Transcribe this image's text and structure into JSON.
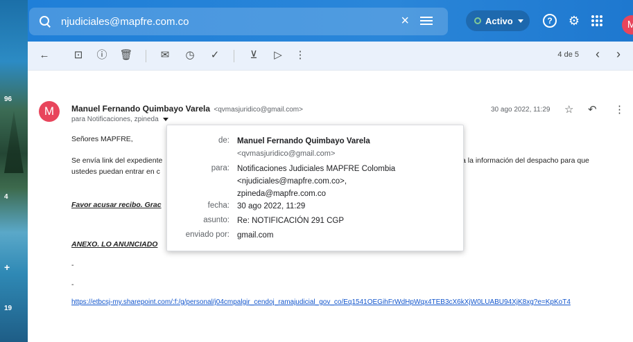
{
  "search": {
    "query": "njudiciales@mapfre.com.co",
    "status": "Activo",
    "avatar_letter": "M"
  },
  "strip_numbers": [
    "96",
    "4",
    "+",
    "19"
  ],
  "toolbar": {
    "pager": "4 de 5"
  },
  "message": {
    "avatar_letter": "M",
    "sender_name": "Manuel Fernando Quimbayo Varela",
    "sender_email": "<qvmasjuridico@gmail.com>",
    "recipients": "para Notificaciones, zpineda",
    "date": "30 ago 2022, 11:29",
    "greeting": "Señores MAPFRE,",
    "line1_start": "Se envía link del expediente",
    "line1_end": "nvía la información del despacho para que",
    "line2": "ustedes puedan entrar en c",
    "ack": "Favor acusar recibo. Grac",
    "annex": "ANEXO.  LO ANUNCIADO",
    "dash": "-",
    "link": "https://etbcsj-my.sharepoint.com/:f:/g/personal/j04cmpalgir_cendoj_ramajudicial_gov_co/Eq1541OEGihFrWdHpWqx4TEB3cX6kXjW0LUABU94XjK8xg?e=KpKoT4"
  },
  "details": {
    "from_label": "de:",
    "from_name": "Manuel Fernando Quimbayo Varela",
    "from_email": "<qvmasjuridico@gmail.com>",
    "to_label": "para:",
    "to_line1": "Notificaciones Judiciales MAPFRE Colombia",
    "to_line2": "<njudiciales@mapfre.com.co>,",
    "to_line3": "zpineda@mapfre.com.co",
    "date_label": "fecha:",
    "date_value": "30 ago 2022, 11:29",
    "subject_label": "asunto:",
    "subject_value": "Re: NOTIFICACIÓN 291 CGP",
    "mailedby_label": "enviado por:",
    "mailedby_value": "gmail.com"
  }
}
